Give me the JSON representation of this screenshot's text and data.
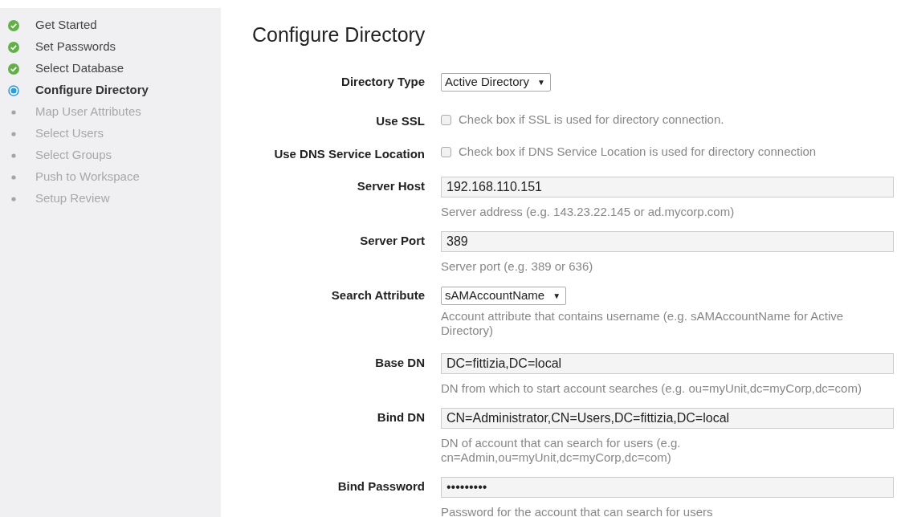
{
  "steps": [
    {
      "label": "Get Started",
      "kind": "done"
    },
    {
      "label": "Set Passwords",
      "kind": "done"
    },
    {
      "label": "Select Database",
      "kind": "done"
    },
    {
      "label": "Configure Directory",
      "kind": "current"
    },
    {
      "label": "Map User Attributes",
      "kind": "pending"
    },
    {
      "label": "Select Users",
      "kind": "pending"
    },
    {
      "label": "Select Groups",
      "kind": "pending"
    },
    {
      "label": "Push to Workspace",
      "kind": "pending"
    },
    {
      "label": "Setup Review",
      "kind": "pending"
    }
  ],
  "title": "Configure Directory",
  "fields": [
    {
      "kind": "select",
      "label": "Directory Type",
      "value": "Active Directory",
      "arrow": "▼"
    },
    {
      "kind": "checkbox",
      "label": "Use SSL",
      "checked": false,
      "text": "Check box if SSL is used for directory connection."
    },
    {
      "kind": "checkbox",
      "label": "Use DNS Service Location",
      "checked": false,
      "text": "Check box if DNS Service Location is used for directory connection"
    },
    {
      "kind": "text",
      "label": "Server Host",
      "value": "192.168.110.151",
      "help": "Server address (e.g. 143.23.22.145 or ad.mycorp.com)"
    },
    {
      "kind": "text",
      "label": "Server Port",
      "value": "389",
      "help": "Server port (e.g. 389 or 636)"
    },
    {
      "kind": "select",
      "label": "Search Attribute",
      "value": "sAMAccountName",
      "arrow": "▼",
      "help": "Account attribute that contains username (e.g. sAMAccountName for Active Directory)"
    },
    {
      "kind": "text",
      "label": "Base DN",
      "value": "DC=fittizia,DC=local",
      "help": "DN from which to start account searches (e.g. ou=myUnit,dc=myCorp,dc=com)"
    },
    {
      "kind": "text",
      "label": "Bind DN",
      "value": "CN=Administrator,CN=Users,DC=fittizia,DC=local",
      "help": "DN of account that can search for users (e.g. cn=Admin,ou=myUnit,dc=myCorp,dc=com)"
    },
    {
      "kind": "text",
      "label": "Bind Password",
      "value": "•••••••••",
      "help": "Password for the account that can search for users"
    }
  ]
}
